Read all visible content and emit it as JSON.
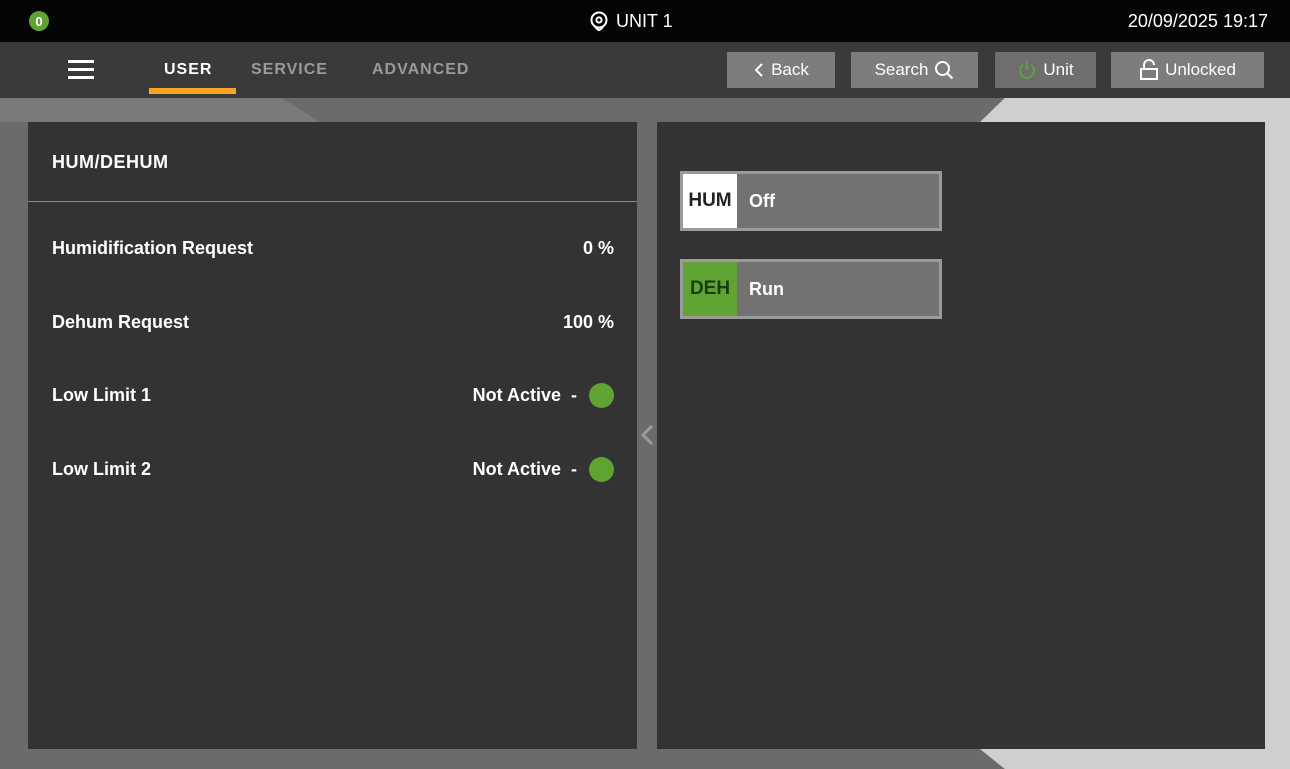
{
  "status_bar": {
    "badge_count": "0",
    "unit_title": "UNIT 1",
    "datetime": "20/09/2025 19:17"
  },
  "nav": {
    "tabs": [
      {
        "label": "USER",
        "active": true
      },
      {
        "label": "SERVICE",
        "active": false
      },
      {
        "label": "ADVANCED",
        "active": false
      }
    ],
    "buttons": {
      "back": "Back",
      "search": "Search",
      "unit": "Unit",
      "lock": "Unlocked"
    }
  },
  "left_panel": {
    "title": "HUM/DEHUM",
    "rows": [
      {
        "label": "Humidification Request",
        "value": "0 %"
      },
      {
        "label": "Dehum Request",
        "value": "100 %"
      },
      {
        "label": "Low Limit 1",
        "value": "Not Active  -"
      },
      {
        "label": "Low Limit 2",
        "value": "Not Active  -"
      }
    ]
  },
  "right_panel": {
    "modes": [
      {
        "code": "HUM",
        "state": "Off",
        "code_bg": "#ffffff",
        "code_color": "#222222"
      },
      {
        "code": "DEH",
        "state": "Run",
        "code_bg": "#5fa332",
        "code_color": "#1e3a10"
      }
    ]
  },
  "colors": {
    "accent": "#f6a623",
    "ok_green": "#5fa332",
    "panel": "#333333"
  }
}
